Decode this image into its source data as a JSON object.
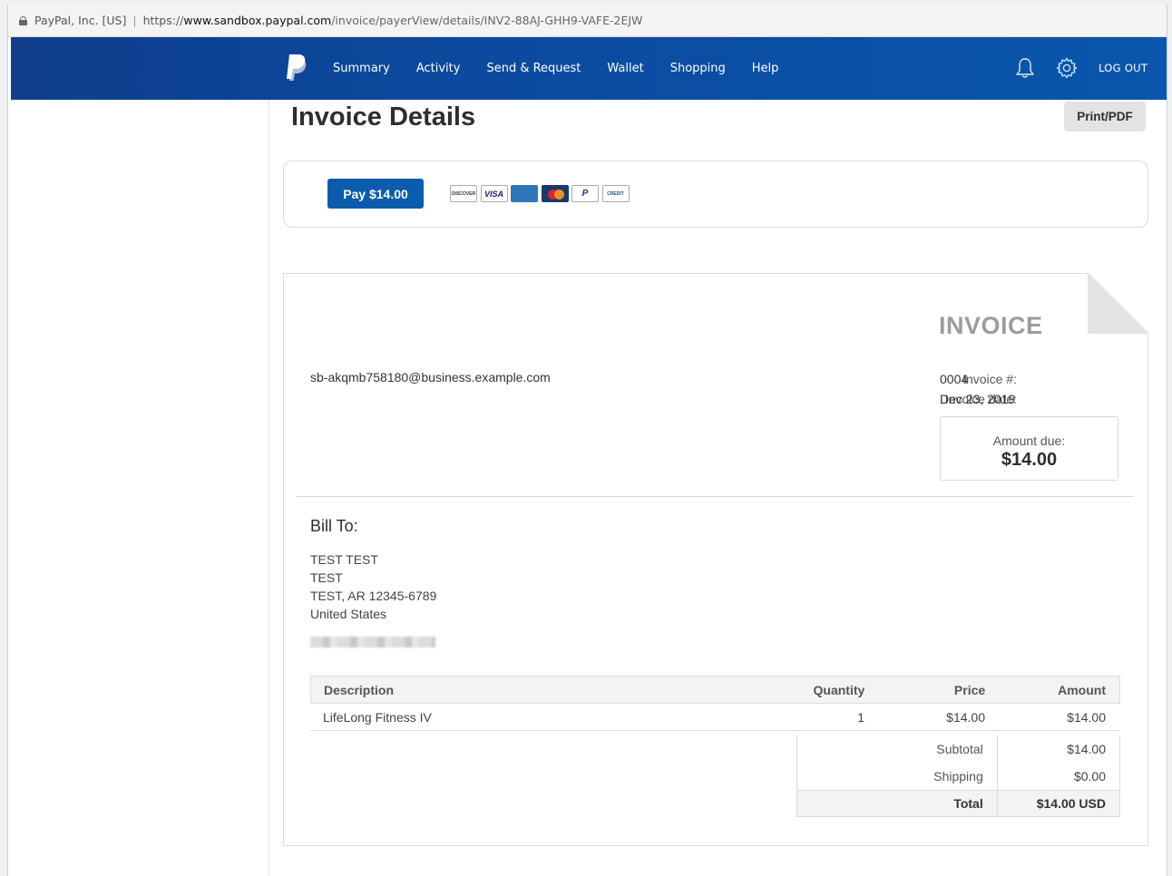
{
  "browser": {
    "site_identity": "PayPal, Inc. [US]",
    "url_proto": "https://",
    "url_host": "www.sandbox.paypal.com",
    "url_path": "/invoice/payerView/details/INV2-88AJ-GHH9-VAFE-2EJW"
  },
  "nav": {
    "items": [
      "Summary",
      "Activity",
      "Send & Request",
      "Wallet",
      "Shopping",
      "Help"
    ],
    "logout": "LOG OUT",
    "icons": [
      "paypal-logo-icon",
      "bell-icon",
      "gear-icon"
    ]
  },
  "page": {
    "title": "Invoice Details",
    "print_label": "Print/PDF"
  },
  "payment": {
    "pay_label": "Pay $14.00",
    "cards": {
      "discover": "DISCOVER",
      "visa": "VISA",
      "amex": "AMEX",
      "mastercard": "",
      "paypal": "P",
      "paypal_credit": "CREDIT"
    }
  },
  "invoice": {
    "heading": "INVOICE",
    "merchant_email": "sb-akqmb758180@business.example.com",
    "number_label": "Invoice #:",
    "number": "0004",
    "date_label": "Invoice date:",
    "date": "Dec 23, 2019",
    "amount_due_label": "Amount due:",
    "amount_due": "$14.00",
    "bill_to_label": "Bill To:",
    "bill_to": {
      "line1": "TEST TEST",
      "line2": "TEST",
      "line3": "TEST, AR 12345-6789",
      "line4": "United States"
    },
    "columns": {
      "description": "Description",
      "quantity": "Quantity",
      "price": "Price",
      "amount": "Amount"
    },
    "items": [
      {
        "description": "LifeLong Fitness IV",
        "quantity": "1",
        "price": "$14.00",
        "amount": "$14.00"
      }
    ],
    "subtotal_label": "Subtotal",
    "subtotal": "$14.00",
    "shipping_label": "Shipping",
    "shipping": "$0.00",
    "total_label": "Total",
    "total": "$14.00 USD"
  },
  "colors": {
    "nav_blue": "#0b4a9e",
    "pay_button": "#0b5cad",
    "invoice_heading": "#9c9c9c"
  }
}
